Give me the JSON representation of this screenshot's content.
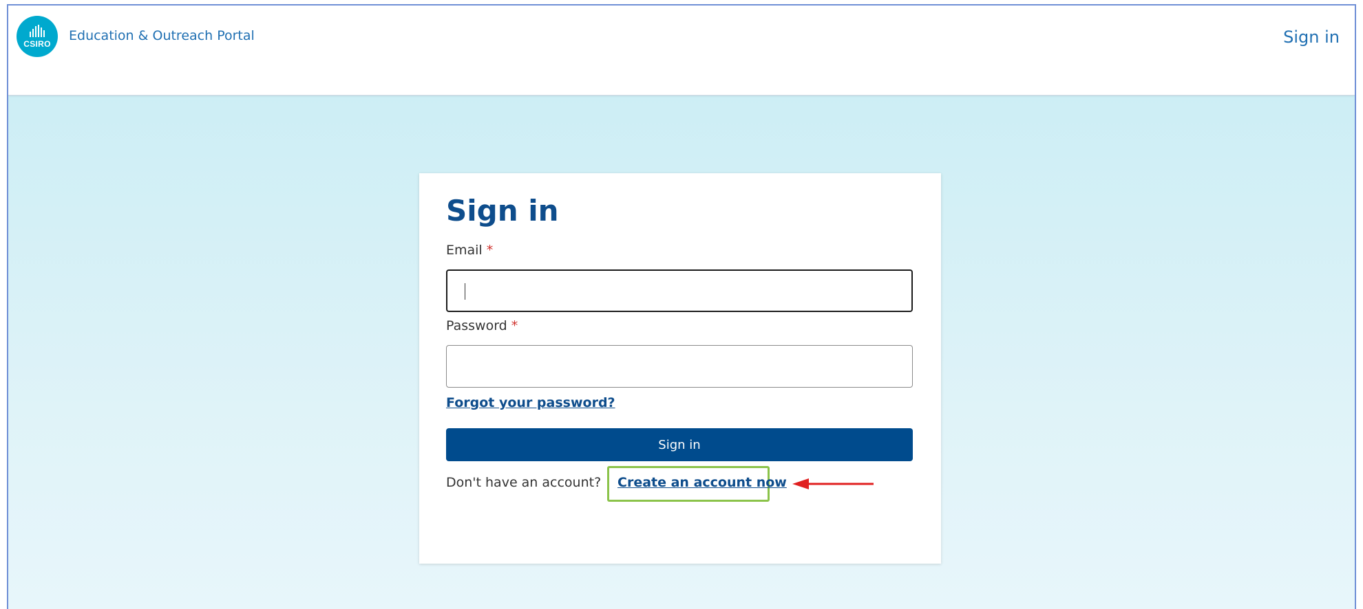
{
  "header": {
    "logo_text": "CSIRO",
    "portal_title": "Education & Outreach Portal",
    "signin_link": "Sign in"
  },
  "form": {
    "title": "Sign in",
    "email_label": "Email",
    "password_label": "Password",
    "required_marker": "*",
    "email_value": "",
    "password_value": "",
    "forgot_password": "Forgot your password?",
    "signin_button": "Sign in",
    "no_account_text": "Don't have an account?",
    "create_account_link": "Create an account now"
  },
  "colors": {
    "brand_blue": "#004b8d",
    "link_blue": "#0e4d8c",
    "logo_teal": "#00a9ce",
    "required_red": "#d0312d",
    "highlight_green": "#8bc34a",
    "annotation_arrow": "#e02020",
    "background": "#cdeef5"
  },
  "icons": {
    "logo": "csiro-logo-icon",
    "annotation": "red-arrow-icon"
  }
}
